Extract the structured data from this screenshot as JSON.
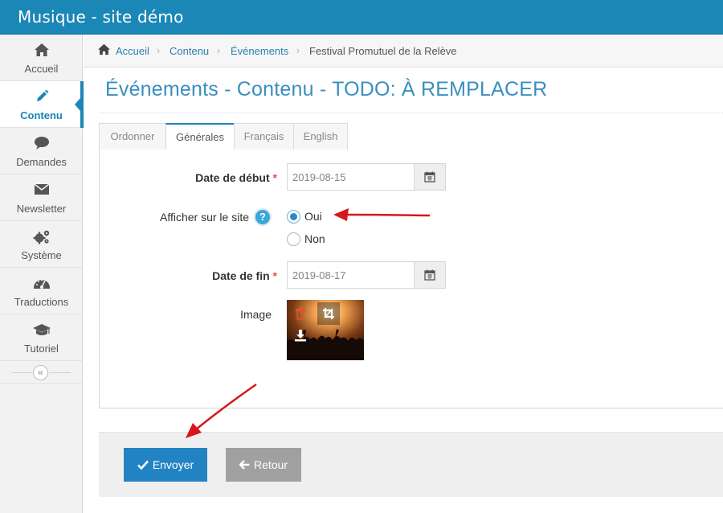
{
  "app": {
    "title": "Musique - site démo"
  },
  "sidebar": {
    "items": [
      {
        "label": "Accueil",
        "icon": "home-icon"
      },
      {
        "label": "Contenu",
        "icon": "pencil-icon",
        "active": true
      },
      {
        "label": "Demandes",
        "icon": "comment-icon"
      },
      {
        "label": "Newsletter",
        "icon": "envelope-icon"
      },
      {
        "label": "Système",
        "icon": "cogs-icon"
      },
      {
        "label": "Traductions",
        "icon": "dashboard-icon"
      },
      {
        "label": "Tutoriel",
        "icon": "graduation-cap-icon"
      }
    ],
    "collapse_glyph": "«"
  },
  "breadcrumb": {
    "items": [
      "Accueil",
      "Contenu",
      "Événements"
    ],
    "current": "Festival Promutuel de la Relève",
    "separator": "›"
  },
  "page": {
    "title": "Événements - Contenu - TODO: À REMPLACER"
  },
  "tabs": [
    {
      "label": "Ordonner"
    },
    {
      "label": "Générales",
      "active": true
    },
    {
      "label": "Français"
    },
    {
      "label": "English"
    }
  ],
  "form": {
    "start_date": {
      "label": "Date de début",
      "required_mark": "*",
      "value": "2019-08-15"
    },
    "show_on_site": {
      "label": "Afficher sur le site",
      "help": "?",
      "options": [
        {
          "label": "Oui",
          "checked": true
        },
        {
          "label": "Non",
          "checked": false
        }
      ]
    },
    "end_date": {
      "label": "Date de fin",
      "required_mark": "*",
      "value": "2019-08-17"
    },
    "image": {
      "label": "Image"
    }
  },
  "actions": {
    "submit": "Envoyer",
    "back": "Retour"
  },
  "colors": {
    "accent": "#1a87b6",
    "primary_button": "#2283c3",
    "secondary_button": "#a0a0a0",
    "required": "#d15b47",
    "annotation_arrow": "#d8161c"
  }
}
